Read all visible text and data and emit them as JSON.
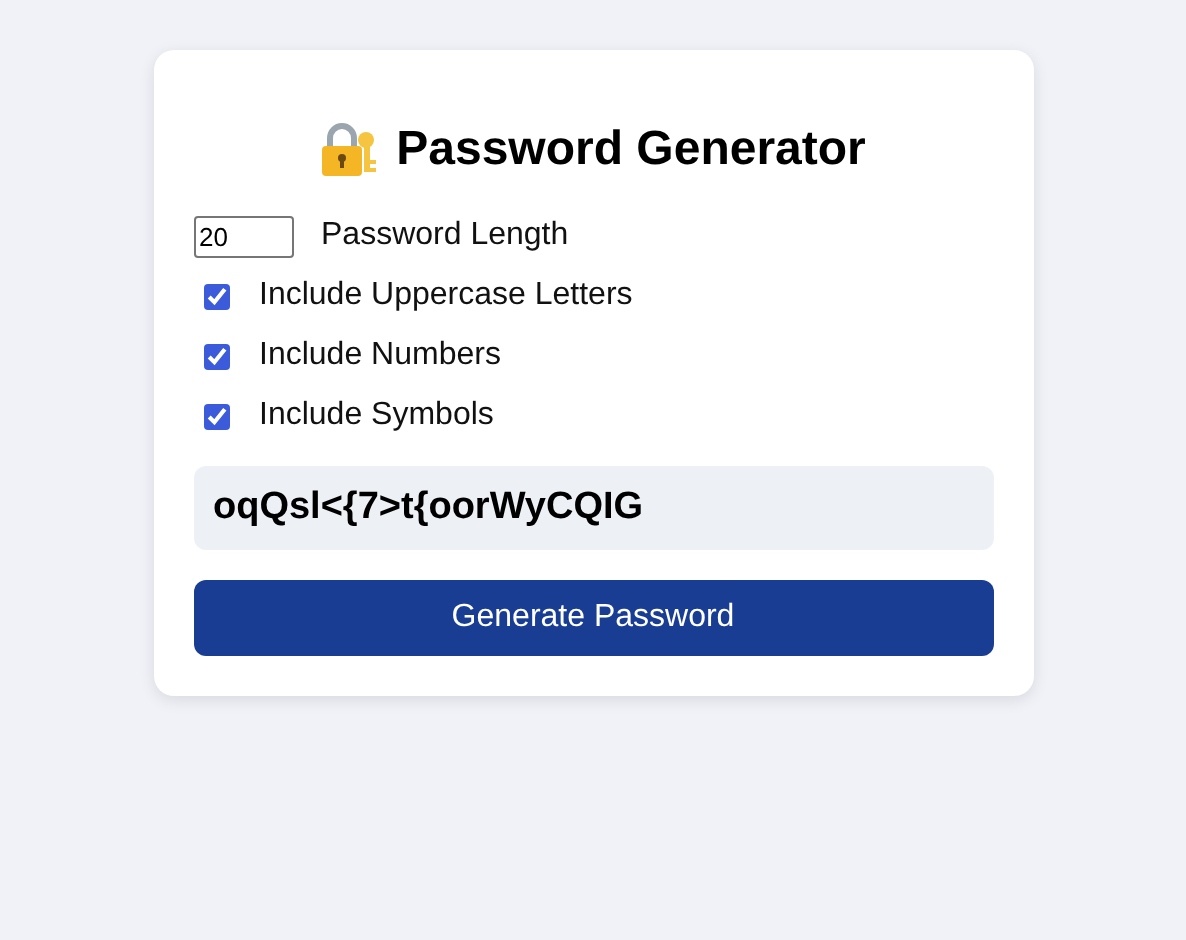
{
  "title": "Password Generator",
  "length": {
    "value": "20",
    "label": "Password Length"
  },
  "options": [
    {
      "label": "Include Uppercase Letters",
      "checked": true
    },
    {
      "label": "Include Numbers",
      "checked": true
    },
    {
      "label": "Include Symbols",
      "checked": true
    }
  ],
  "password": "oqQsl<{7>t{oorWyCQIG",
  "button": "Generate Password"
}
